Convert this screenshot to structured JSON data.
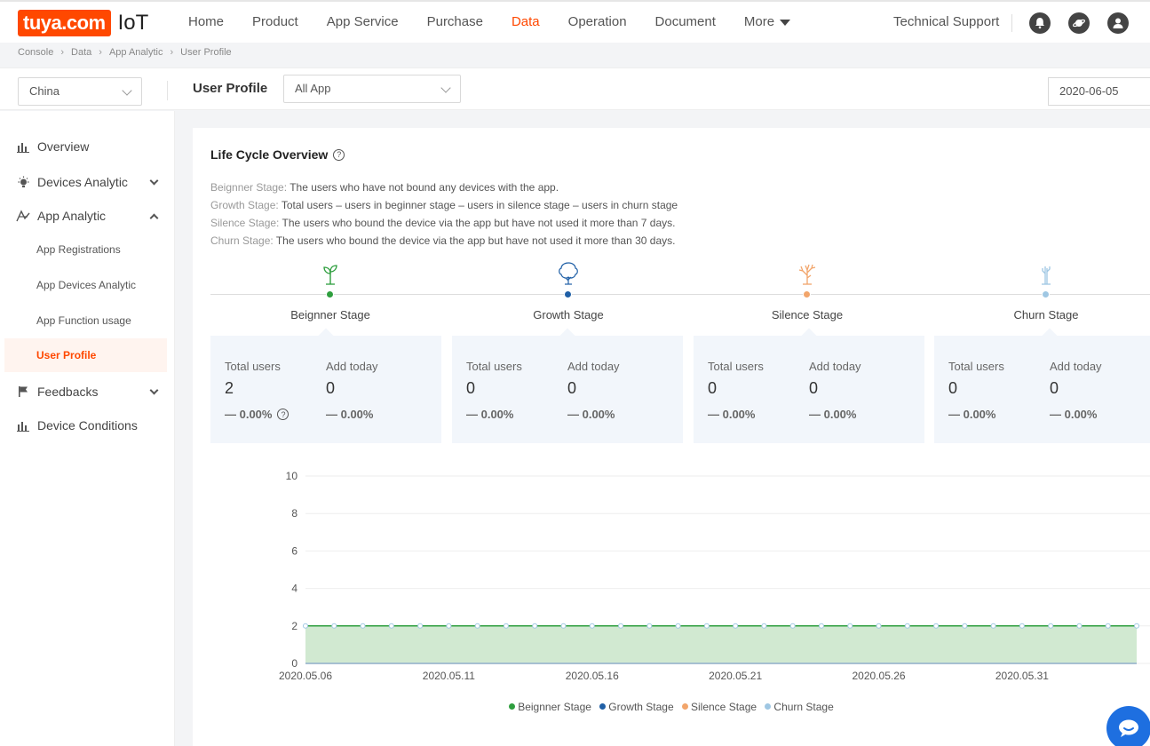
{
  "brand": {
    "logo_text": "tuya.com",
    "product": "IoT"
  },
  "nav": {
    "items": [
      "Home",
      "Product",
      "App Service",
      "Purchase",
      "Data",
      "Operation",
      "Document",
      "More"
    ],
    "active": "Data",
    "support": "Technical Support"
  },
  "breadcrumb": [
    "Console",
    "Data",
    "App Analytic",
    "User Profile"
  ],
  "filters": {
    "region": "China",
    "page_title": "User Profile",
    "app": "All App",
    "date": "2020-06-05"
  },
  "sidebar": {
    "items": [
      {
        "label": "Overview",
        "icon": "bar-chart-icon"
      },
      {
        "label": "Devices Analytic",
        "icon": "bulb-icon",
        "expandable": true
      },
      {
        "label": "App Analytic",
        "icon": "app-analytic-icon",
        "expanded": true
      },
      {
        "label": "Feedbacks",
        "icon": "flag-icon",
        "expandable": true
      },
      {
        "label": "Device Conditions",
        "icon": "bar-chart-icon"
      }
    ],
    "sub_items": [
      "App Registrations",
      "App Devices Analytic",
      "App Function usage",
      "User Profile"
    ],
    "active_sub": "User Profile"
  },
  "lifecycle": {
    "title": "Life Cycle Overview",
    "descriptions": [
      {
        "label": "Beignner Stage:",
        "text": "The users who have not bound any devices with the app."
      },
      {
        "label": "Growth Stage:",
        "text": "Total users – users in beginner stage – users in silence stage – users in churn stage"
      },
      {
        "label": "Silence Stage:",
        "text": "The users who bound the device via the app but have not used it more than 7 days."
      },
      {
        "label": "Churn Stage:",
        "text": "The users who bound the device via the app but have not used it more than 30 days."
      }
    ],
    "stages": [
      {
        "name": "Beignner Stage",
        "color": "#2e9e3e",
        "icon": "sprout-icon",
        "total_label": "Total users",
        "total": "2",
        "total_pct": "— 0.00%",
        "add_label": "Add today",
        "add": "0",
        "add_pct": "— 0.00%"
      },
      {
        "name": "Growth Stage",
        "color": "#1f5fa6",
        "icon": "tree-icon",
        "total_label": "Total users",
        "total": "0",
        "total_pct": "— 0.00%",
        "add_label": "Add today",
        "add": "0",
        "add_pct": "— 0.00%"
      },
      {
        "name": "Silence Stage",
        "color": "#f2a56b",
        "icon": "bare-tree-icon",
        "total_label": "Total users",
        "total": "0",
        "total_pct": "— 0.00%",
        "add_label": "Add today",
        "add": "0",
        "add_pct": "— 0.00%"
      },
      {
        "name": "Churn Stage",
        "color": "#9fc7e3",
        "icon": "dead-tree-icon",
        "total_label": "Total users",
        "total": "0",
        "total_pct": "— 0.00%",
        "add_label": "Add today",
        "add": "0",
        "add_pct": "— 0.00%"
      }
    ]
  },
  "chart_data": {
    "type": "area",
    "x_tick_labels": [
      "2020.05.06",
      "2020.05.11",
      "2020.05.16",
      "2020.05.21",
      "2020.05.26",
      "2020.05.31"
    ],
    "x": [
      "2020-05-06",
      "2020-05-07",
      "2020-05-08",
      "2020-05-09",
      "2020-05-10",
      "2020-05-11",
      "2020-05-12",
      "2020-05-13",
      "2020-05-14",
      "2020-05-15",
      "2020-05-16",
      "2020-05-17",
      "2020-05-18",
      "2020-05-19",
      "2020-05-20",
      "2020-05-21",
      "2020-05-22",
      "2020-05-23",
      "2020-05-24",
      "2020-05-25",
      "2020-05-26",
      "2020-05-27",
      "2020-05-28",
      "2020-05-29",
      "2020-05-30",
      "2020-05-31",
      "2020-06-01",
      "2020-06-02",
      "2020-06-03",
      "2020-06-04"
    ],
    "series": [
      {
        "name": "Beignner Stage",
        "color": "#2e9e3e",
        "values": [
          2,
          2,
          2,
          2,
          2,
          2,
          2,
          2,
          2,
          2,
          2,
          2,
          2,
          2,
          2,
          2,
          2,
          2,
          2,
          2,
          2,
          2,
          2,
          2,
          2,
          2,
          2,
          2,
          2,
          2
        ]
      },
      {
        "name": "Growth Stage",
        "color": "#1f5fa6",
        "values": [
          0,
          0,
          0,
          0,
          0,
          0,
          0,
          0,
          0,
          0,
          0,
          0,
          0,
          0,
          0,
          0,
          0,
          0,
          0,
          0,
          0,
          0,
          0,
          0,
          0,
          0,
          0,
          0,
          0,
          0
        ]
      },
      {
        "name": "Silence Stage",
        "color": "#f2a56b",
        "values": [
          0,
          0,
          0,
          0,
          0,
          0,
          0,
          0,
          0,
          0,
          0,
          0,
          0,
          0,
          0,
          0,
          0,
          0,
          0,
          0,
          0,
          0,
          0,
          0,
          0,
          0,
          0,
          0,
          0,
          0
        ]
      },
      {
        "name": "Churn Stage",
        "color": "#9fc7e3",
        "values": [
          0,
          0,
          0,
          0,
          0,
          0,
          0,
          0,
          0,
          0,
          0,
          0,
          0,
          0,
          0,
          0,
          0,
          0,
          0,
          0,
          0,
          0,
          0,
          0,
          0,
          0,
          0,
          0,
          0,
          0
        ]
      }
    ],
    "y_ticks": [
      0,
      2,
      4,
      6,
      8,
      10
    ],
    "ylim": [
      0,
      10
    ],
    "legend_position": "bottom"
  }
}
